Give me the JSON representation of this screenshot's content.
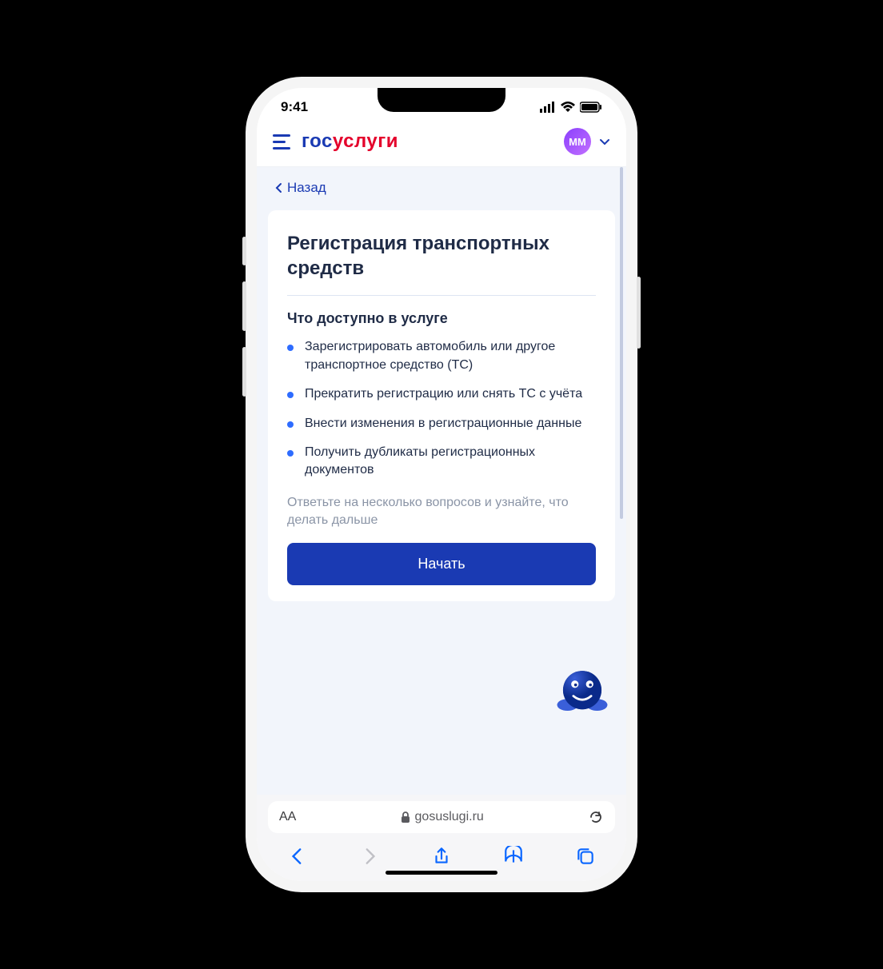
{
  "status": {
    "time": "9:41"
  },
  "header": {
    "logo_part1": "гос",
    "logo_part2": "услуги",
    "avatar_initials": "ММ"
  },
  "back_label": "Назад",
  "page": {
    "title": "Регистрация транспортных средств",
    "subtitle": "Что доступно в услуге",
    "bullets": [
      "Зарегистрировать автомобиль или другое транспортное средство (ТС)",
      "Прекратить регистрацию или снять ТС с учёта",
      "Внести изменения в регистрационные данные",
      "Получить дубликаты регистрационных документов"
    ],
    "hint": "Ответьте на несколько вопросов и узнайте, что делать дальше",
    "start_label": "Начать"
  },
  "browser": {
    "font_size_label": "AA",
    "url": "gosuslugi.ru"
  }
}
